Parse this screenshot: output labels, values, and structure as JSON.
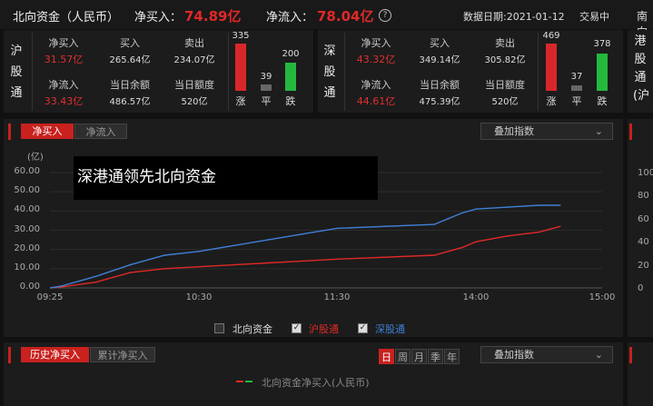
{
  "header": {
    "title": "北向资金（人民币）",
    "net_buy_label": "净买入：",
    "net_buy_value": "74.89亿",
    "net_inflow_label": "净流入：",
    "net_inflow_value": "78.04亿",
    "help_glyph": "?",
    "date_text": "数据日期:2021-01-12",
    "status_text": "交易中",
    "south_label": "南向"
  },
  "sh": {
    "name": [
      "沪",
      "股",
      "通"
    ],
    "net_buy_label": "净买入",
    "net_buy_value": "31.57亿",
    "buy_label": "买入",
    "buy_value": "265.64亿",
    "sell_label": "卖出",
    "sell_value": "234.07亿",
    "net_inflow_label": "净流入",
    "net_inflow_value": "33.43亿",
    "balance_label": "当日余额",
    "balance_value": "486.57亿",
    "quota_label": "当日额度",
    "quota_value": "520亿",
    "up_count": "335",
    "flat_count": "39",
    "down_count": "200",
    "up_label": "涨",
    "flat_label": "平",
    "down_label": "跌"
  },
  "sz": {
    "name": [
      "深",
      "股",
      "通"
    ],
    "net_buy_label": "净买入",
    "net_buy_value": "43.32亿",
    "buy_label": "买入",
    "buy_value": "349.14亿",
    "sell_label": "卖出",
    "sell_value": "305.82亿",
    "net_inflow_label": "净流入",
    "net_inflow_value": "44.61亿",
    "balance_label": "当日余额",
    "balance_value": "475.39亿",
    "quota_label": "当日额度",
    "quota_value": "520亿",
    "up_count": "469",
    "flat_count": "37",
    "down_count": "378",
    "up_label": "涨",
    "flat_label": "平",
    "down_label": "跌"
  },
  "hk_side": {
    "name": [
      "港",
      "股",
      "通",
      "(沪"
    ]
  },
  "chart_tabs": {
    "net_buy": "净买入",
    "net_inflow": "净流入",
    "index_dropdown": "叠加指数"
  },
  "overlay_text": "深港通领先北向资金",
  "legend": {
    "north": "北向资金",
    "sh": "沪股通",
    "sz": "深股通",
    "check": "✓"
  },
  "right_ticks": [
    "100",
    "80",
    "60",
    "40",
    "20",
    "0"
  ],
  "history": {
    "tab_hist": "历史净买入",
    "tab_cum": "累计净买入",
    "periods": [
      "日",
      "周",
      "月",
      "季",
      "年"
    ],
    "index_dropdown": "叠加指数",
    "legend_label": "北向资金净买入(人民币)"
  },
  "colors": {
    "accent": "#c8211e",
    "up": "#e03030",
    "down": "#25b83e",
    "sh_line": "#e02828",
    "sz_line": "#3f7fd6"
  },
  "chart_data": {
    "type": "line",
    "yunit": "(亿)",
    "ylim": [
      0,
      60
    ],
    "yticks": [
      0,
      10,
      20,
      30,
      40,
      50,
      60
    ],
    "xticks": [
      "09:25",
      "10:30",
      "11:30",
      "14:00",
      "15:00"
    ],
    "series": [
      {
        "name": "沪股通",
        "color": "#e02828",
        "x": [
          "09:30",
          "09:45",
          "10:00",
          "10:15",
          "10:30",
          "10:45",
          "11:00",
          "11:15",
          "11:30",
          "13:15",
          "13:30",
          "13:45",
          "14:00",
          "14:15",
          "14:30",
          "14:40"
        ],
        "values": [
          0.5,
          3,
          8,
          10,
          11,
          12,
          13,
          14,
          15,
          17,
          19,
          21,
          24,
          27,
          29,
          32
        ]
      },
      {
        "name": "深股通",
        "color": "#3f7fd6",
        "x": [
          "09:30",
          "09:45",
          "10:00",
          "10:15",
          "10:30",
          "10:45",
          "11:00",
          "11:15",
          "11:30",
          "13:15",
          "13:30",
          "13:45",
          "14:00",
          "14:15",
          "14:30",
          "14:40"
        ],
        "values": [
          1,
          6,
          12,
          17,
          19,
          22,
          25,
          28,
          31,
          33,
          36,
          39,
          41,
          42,
          43,
          43
        ]
      }
    ]
  }
}
